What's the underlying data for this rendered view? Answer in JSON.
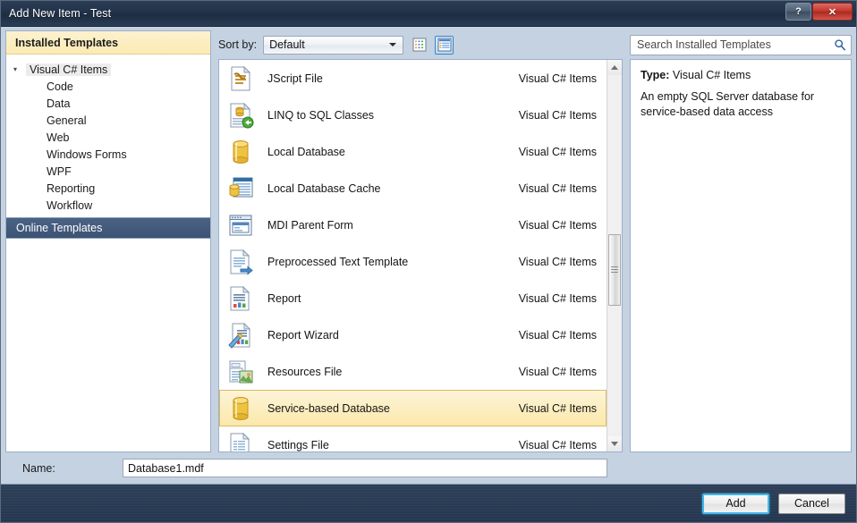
{
  "window": {
    "title": "Add New Item - Test",
    "help_button": "?",
    "close_button": "✕"
  },
  "sidebar": {
    "installed_header": "Installed Templates",
    "tree_root": "Visual C# Items",
    "tree_children": [
      "Code",
      "Data",
      "General",
      "Web",
      "Windows Forms",
      "WPF",
      "Reporting",
      "Workflow"
    ],
    "online_templates": "Online Templates"
  },
  "toolbar": {
    "sort_by_label": "Sort by:",
    "sort_by_value": "Default",
    "view_icon_grid": "grid-view-icon",
    "view_icon_list": "list-view-icon"
  },
  "search": {
    "placeholder": "Search Installed Templates",
    "value": "",
    "icon": "search-icon"
  },
  "details": {
    "type_label": "Type:",
    "type_value": "Visual C# Items",
    "description": "An empty SQL Server database for service-based data access"
  },
  "list": {
    "category_all": "Visual C# Items",
    "items": [
      {
        "name": "JScript File",
        "category": "Visual C# Items",
        "icon": "jscript-file-icon",
        "selected": false
      },
      {
        "name": "LINQ to SQL Classes",
        "category": "Visual C# Items",
        "icon": "linq-to-sql-icon",
        "selected": false
      },
      {
        "name": "Local Database",
        "category": "Visual C# Items",
        "icon": "database-icon",
        "selected": false
      },
      {
        "name": "Local Database Cache",
        "category": "Visual C# Items",
        "icon": "database-cache-icon",
        "selected": false
      },
      {
        "name": "MDI Parent Form",
        "category": "Visual C# Items",
        "icon": "mdi-form-icon",
        "selected": false
      },
      {
        "name": "Preprocessed Text Template",
        "category": "Visual C# Items",
        "icon": "text-template-icon",
        "selected": false
      },
      {
        "name": "Report",
        "category": "Visual C# Items",
        "icon": "report-icon",
        "selected": false
      },
      {
        "name": "Report Wizard",
        "category": "Visual C# Items",
        "icon": "report-wizard-icon",
        "selected": false
      },
      {
        "name": "Resources File",
        "category": "Visual C# Items",
        "icon": "resources-file-icon",
        "selected": false
      },
      {
        "name": "Service-based Database",
        "category": "Visual C# Items",
        "icon": "database-icon",
        "selected": true
      },
      {
        "name": "Settings File",
        "category": "Visual C# Items",
        "icon": "settings-file-icon",
        "selected": false
      }
    ]
  },
  "name_field": {
    "label": "Name:",
    "value": "Database1.mdf"
  },
  "footer": {
    "add_label": "Add",
    "cancel_label": "Cancel"
  },
  "colors": {
    "titlebar": "#223349",
    "accent_yellow": "#fbe8ab",
    "online_bar": "#3d5374",
    "default_button_focus": "#43b7e8",
    "close_button": "#c1352c"
  }
}
